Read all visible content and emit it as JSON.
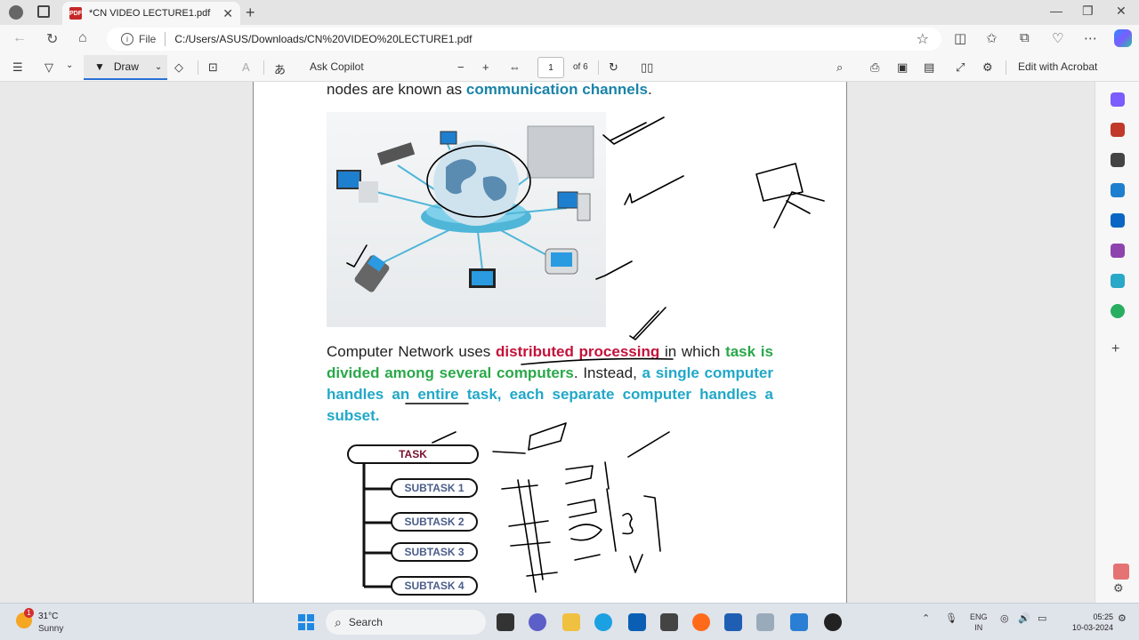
{
  "browser": {
    "tab_title": "*CN VIDEO LECTURE1.pdf",
    "tab_icon_label": "PDF",
    "address_prefix": "File",
    "url": "C:/Users/ASUS/Downloads/CN%20VIDEO%20LECTURE1.pdf"
  },
  "pdf_toolbar": {
    "draw_label": "Draw",
    "ask_copilot": "Ask Copilot",
    "page_number": "1",
    "page_total": "of 6",
    "edit_acrobat": "Edit with Acrobat"
  },
  "document": {
    "line1_plain": "nodes are known as ",
    "line1_bold": "communication channels",
    "line1_end": ".",
    "para_plain1": "Computer Network uses ",
    "para_red": "distributed processing",
    "para_plain2": " in which ",
    "para_green": "task is divided among several computers",
    "para_plain3": ". Instead, ",
    "para_cyan": "a single computer handles an entire task, each separate computer handles a subset.",
    "diagram": {
      "task": "TASK",
      "subtasks": [
        "SUBTASK 1",
        "SUBTASK 2",
        "SUBTASK 3",
        "SUBTASK 4"
      ]
    }
  },
  "taskbar": {
    "weather_temp": "31°C",
    "weather_cond": "Sunny",
    "weather_badge": "1",
    "search_label": "Search",
    "lang_top": "ENG",
    "lang_bottom": "IN",
    "time": "05:25",
    "date": "10-03-2024"
  },
  "colors": {
    "accent": "#2a6fd6",
    "teal_text": "#1a84a8",
    "red_text": "#c4123a",
    "green_text": "#2aa84a",
    "cyan_text": "#21a8c8",
    "subtask_text": "#4b5e8a",
    "task_text": "#7a1030"
  }
}
